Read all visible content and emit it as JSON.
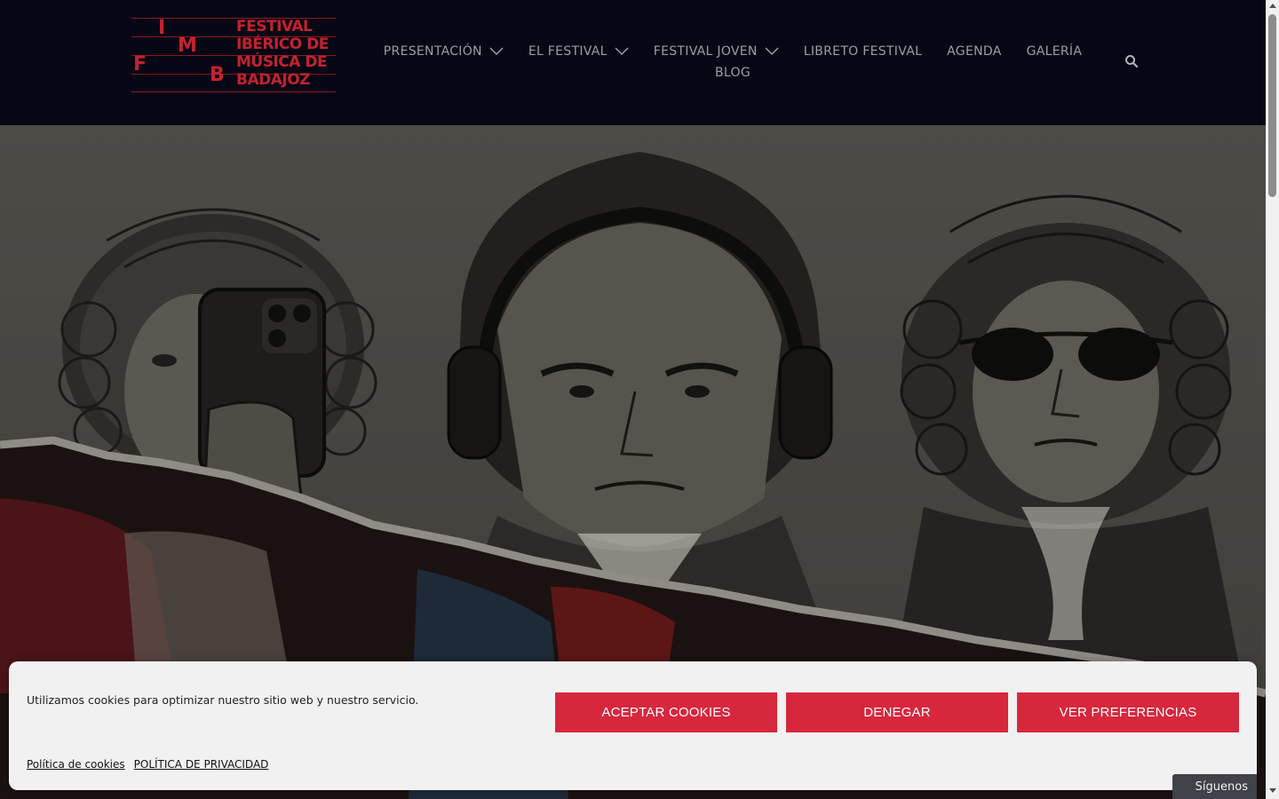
{
  "logo": {
    "letters": [
      "I",
      "M",
      "F",
      "B"
    ],
    "wordmark_lines": [
      "FESTIVAL",
      "IBÉRICO DE",
      "MÚSICA DE",
      "BADAJOZ"
    ]
  },
  "nav": {
    "items": [
      {
        "label": "PRESENTACIÓN",
        "dropdown": true
      },
      {
        "label": "EL FESTIVAL",
        "dropdown": true
      },
      {
        "label": "FESTIVAL JOVEN",
        "dropdown": true
      },
      {
        "label": "LIBRETO FESTIVAL",
        "dropdown": false
      },
      {
        "label": "AGENDA",
        "dropdown": false
      },
      {
        "label": "GALERÍA",
        "dropdown": false
      }
    ],
    "second_row": {
      "label": "BLOG"
    },
    "search_icon": "search-icon"
  },
  "cookie": {
    "message": "Utilizamos cookies para optimizar nuestro sitio web y nuestro servicio.",
    "accept_label": "ACEPTAR COOKIES",
    "deny_label": "DENEGAR",
    "prefs_label": "VER PREFERENCIAS",
    "links": [
      "Política de cookies",
      "POLÍTICA DE PRIVACIDAD"
    ]
  },
  "follow": {
    "label": "Síguenos"
  },
  "colors": {
    "header_bg": "#050814",
    "brand_red": "#c4212f",
    "button_red": "#d6273d",
    "nav_text": "#9b9ea8",
    "banner_bg": "#f1f1f1"
  }
}
